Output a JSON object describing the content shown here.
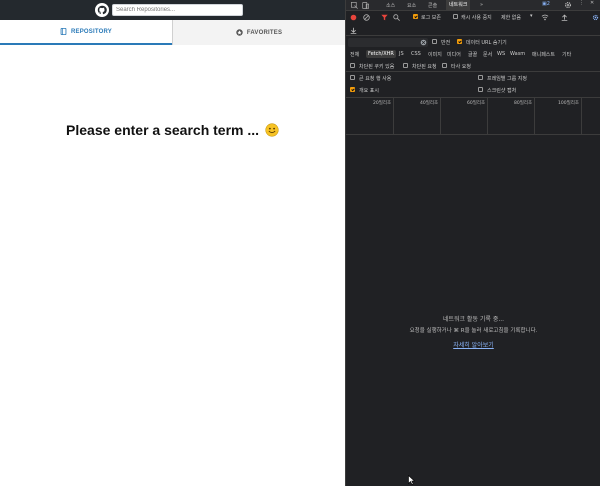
{
  "app": {
    "search": {
      "placeholder": "Search Repositories...",
      "value": ""
    },
    "tabs": [
      {
        "label": "REPOSITORY",
        "icon": "book-icon",
        "active": true
      },
      {
        "label": "FAVORITES",
        "icon": "star-circle-icon",
        "active": false
      }
    ],
    "prompt": "Please enter a search term ..."
  },
  "devtools": {
    "tabs": [
      "소스",
      "요소",
      "콘솔",
      "네트워크",
      "»"
    ],
    "active_tab": "네트워크",
    "issues_count": "2",
    "toolbar": {
      "preserve_log": "로그 보존",
      "disable_cache": "캐시 사용 중지",
      "throttle": "제한 없음"
    },
    "filter_row": {
      "invert": "반전",
      "hide_data_urls": "데이터 URL 숨기기"
    },
    "type_filters": [
      "전체",
      "Fetch/XHR",
      "JS",
      "CSS",
      "이미지",
      "미디어",
      "글꼴",
      "문서",
      "WS",
      "Wasm",
      "매니페스트",
      "기타"
    ],
    "active_filter": "Fetch/XHR",
    "blocked_row": {
      "blocked_cookies": "차단된 쿠키 있음",
      "blocked_requests": "차단된 요청",
      "third_party": "타사 요청"
    },
    "settings": {
      "big_rows": "큰 요청 행 사용",
      "group_by_frame": "프레임별 그룹 지정",
      "overview": "개요 표시",
      "screenshots": "스크린샷 캡처"
    },
    "timeline_labels": [
      "20밀리초",
      "40밀리초",
      "60밀리초",
      "80밀리초",
      "100밀리초"
    ],
    "empty": {
      "title": "네트워크 활동 기록 중...",
      "description": "요청을 실행하거나 ⌘ R을 눌러 새로고침을 기록합니다.",
      "link": "자세히 알아보기"
    }
  },
  "colors": {
    "header_bg": "#24292e",
    "accent": "#2a7ab8",
    "devtools_bg": "#202124",
    "checkbox_on": "#f59e0b",
    "record": "#e8453c",
    "link": "#8ab4f8"
  }
}
